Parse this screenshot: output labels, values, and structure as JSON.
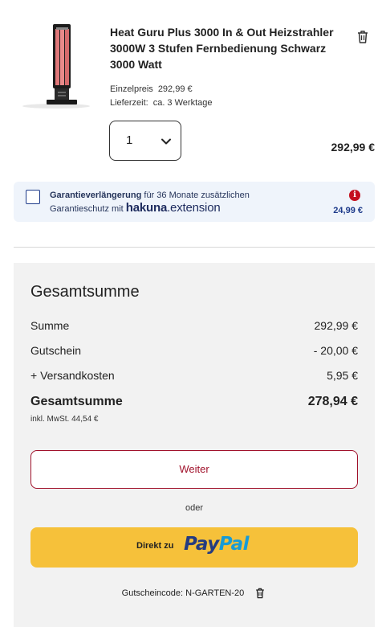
{
  "cart_item": {
    "title": "Heat Guru Plus 3000 In & Out Heizstrahler 3000W 3 Stufen Fernbedienung Schwarz 3000 Watt",
    "unit_price_label": "Einzelpreis",
    "unit_price": "292,99 €",
    "delivery_label": "Lieferzeit:",
    "delivery_value": "ca. 3 Werktage",
    "quantity": "1",
    "line_total": "292,99 €",
    "icons": {
      "remove": "trash-icon",
      "dropdown": "chevron-down-icon"
    }
  },
  "warranty": {
    "bold_text": "Garantieverlängerung",
    "text_1": " für 36 Monate zusätzlichen",
    "text_2": "Garantieschutz mit ",
    "brand_bold": "hakuna",
    "brand_rest": ".extension",
    "price": "24,99 €",
    "info_glyph": "i",
    "checked": false
  },
  "summary": {
    "heading": "Gesamtsumme",
    "rows": [
      {
        "label": "Summe",
        "amount": "292,99 €"
      },
      {
        "label": "Gutschein",
        "amount": "- 20,00 €"
      },
      {
        "label": "+ Versandkosten",
        "amount": "5,95 €"
      }
    ],
    "total_label": "Gesamtsumme",
    "total_amount": "278,94 €",
    "tax_note": "inkl. MwSt. 44,54 €",
    "next_button": "Weiter",
    "or_text": "oder",
    "paypal_prefix": "Direkt zu",
    "paypal_pay": "Pay",
    "paypal_pal": "Pal",
    "coupon_text": "Gutscheincode: N-GARTEN-20"
  },
  "colors": {
    "accent_red": "#a0102a",
    "paypal_yellow": "#f6c13a",
    "warranty_bg": "#eff4fb",
    "summary_bg": "#f2f2f2",
    "navy": "#1d3a8a"
  }
}
